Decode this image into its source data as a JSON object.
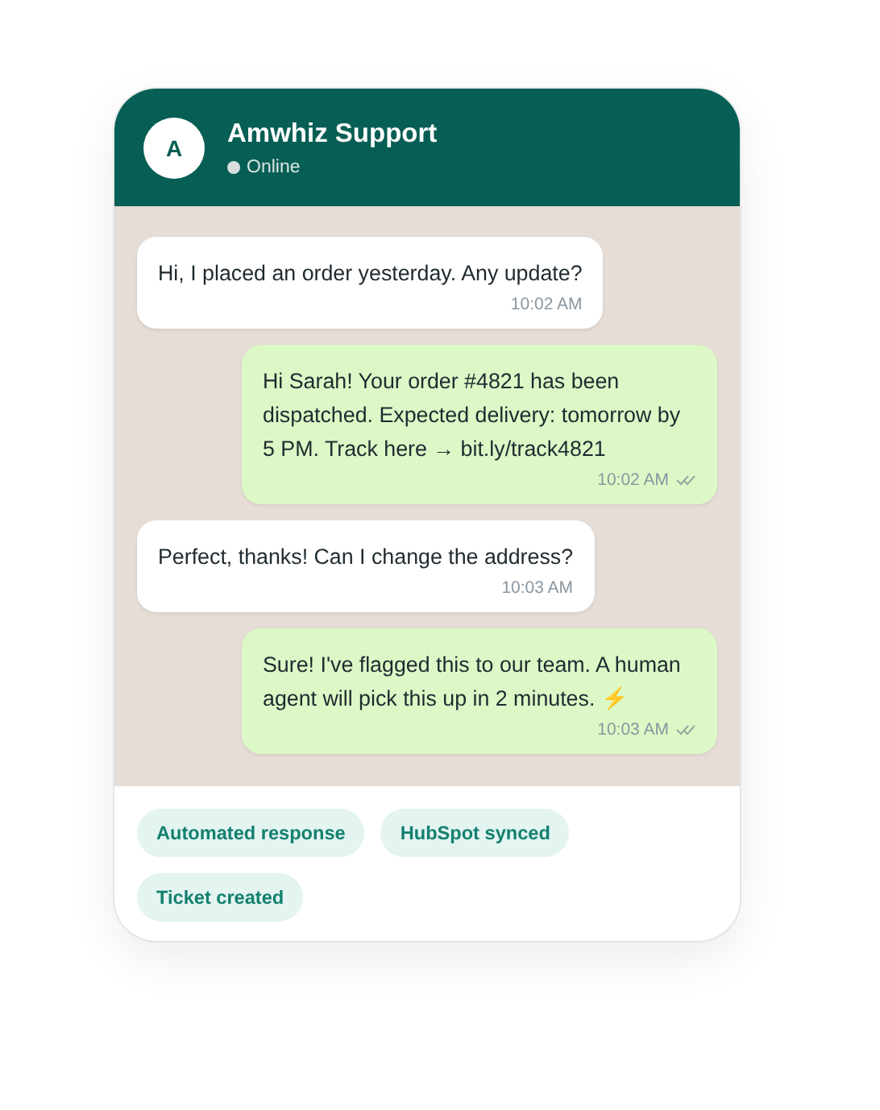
{
  "header": {
    "avatar": "A",
    "title": "Amwhiz Support",
    "status": "Online"
  },
  "messages": [
    {
      "kind": "in",
      "text": "Hi, I placed an order yesterday. Any update?",
      "time": "10:02 AM"
    },
    {
      "kind": "out",
      "text": "Hi Sarah! Your order #4821 has been dispatched. Expected delivery: tomorrow by 5 PM. Track here → bit.ly/track4821",
      "time": "10:02 AM"
    },
    {
      "kind": "in",
      "text": "Perfect, thanks! Can I change the address?",
      "time": "10:03 AM"
    },
    {
      "kind": "out",
      "text": "Sure! I've flagged this to our team. A human agent will pick this up in 2 minutes. ⚡",
      "time": "10:03 AM"
    }
  ],
  "tags": [
    "Automated response",
    "HubSpot synced",
    "Ticket created"
  ]
}
